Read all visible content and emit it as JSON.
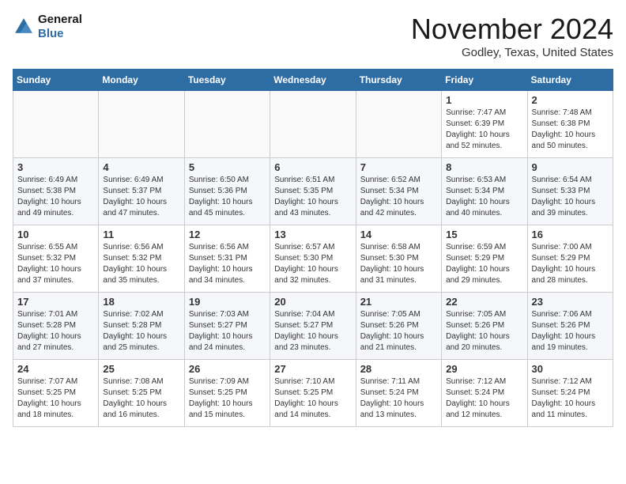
{
  "header": {
    "logo_line1": "General",
    "logo_line2": "Blue",
    "month": "November 2024",
    "location": "Godley, Texas, United States"
  },
  "weekdays": [
    "Sunday",
    "Monday",
    "Tuesday",
    "Wednesday",
    "Thursday",
    "Friday",
    "Saturday"
  ],
  "weeks": [
    [
      {
        "day": "",
        "info": ""
      },
      {
        "day": "",
        "info": ""
      },
      {
        "day": "",
        "info": ""
      },
      {
        "day": "",
        "info": ""
      },
      {
        "day": "",
        "info": ""
      },
      {
        "day": "1",
        "info": "Sunrise: 7:47 AM\nSunset: 6:39 PM\nDaylight: 10 hours\nand 52 minutes."
      },
      {
        "day": "2",
        "info": "Sunrise: 7:48 AM\nSunset: 6:38 PM\nDaylight: 10 hours\nand 50 minutes."
      }
    ],
    [
      {
        "day": "3",
        "info": "Sunrise: 6:49 AM\nSunset: 5:38 PM\nDaylight: 10 hours\nand 49 minutes."
      },
      {
        "day": "4",
        "info": "Sunrise: 6:49 AM\nSunset: 5:37 PM\nDaylight: 10 hours\nand 47 minutes."
      },
      {
        "day": "5",
        "info": "Sunrise: 6:50 AM\nSunset: 5:36 PM\nDaylight: 10 hours\nand 45 minutes."
      },
      {
        "day": "6",
        "info": "Sunrise: 6:51 AM\nSunset: 5:35 PM\nDaylight: 10 hours\nand 43 minutes."
      },
      {
        "day": "7",
        "info": "Sunrise: 6:52 AM\nSunset: 5:34 PM\nDaylight: 10 hours\nand 42 minutes."
      },
      {
        "day": "8",
        "info": "Sunrise: 6:53 AM\nSunset: 5:34 PM\nDaylight: 10 hours\nand 40 minutes."
      },
      {
        "day": "9",
        "info": "Sunrise: 6:54 AM\nSunset: 5:33 PM\nDaylight: 10 hours\nand 39 minutes."
      }
    ],
    [
      {
        "day": "10",
        "info": "Sunrise: 6:55 AM\nSunset: 5:32 PM\nDaylight: 10 hours\nand 37 minutes."
      },
      {
        "day": "11",
        "info": "Sunrise: 6:56 AM\nSunset: 5:32 PM\nDaylight: 10 hours\nand 35 minutes."
      },
      {
        "day": "12",
        "info": "Sunrise: 6:56 AM\nSunset: 5:31 PM\nDaylight: 10 hours\nand 34 minutes."
      },
      {
        "day": "13",
        "info": "Sunrise: 6:57 AM\nSunset: 5:30 PM\nDaylight: 10 hours\nand 32 minutes."
      },
      {
        "day": "14",
        "info": "Sunrise: 6:58 AM\nSunset: 5:30 PM\nDaylight: 10 hours\nand 31 minutes."
      },
      {
        "day": "15",
        "info": "Sunrise: 6:59 AM\nSunset: 5:29 PM\nDaylight: 10 hours\nand 29 minutes."
      },
      {
        "day": "16",
        "info": "Sunrise: 7:00 AM\nSunset: 5:29 PM\nDaylight: 10 hours\nand 28 minutes."
      }
    ],
    [
      {
        "day": "17",
        "info": "Sunrise: 7:01 AM\nSunset: 5:28 PM\nDaylight: 10 hours\nand 27 minutes."
      },
      {
        "day": "18",
        "info": "Sunrise: 7:02 AM\nSunset: 5:28 PM\nDaylight: 10 hours\nand 25 minutes."
      },
      {
        "day": "19",
        "info": "Sunrise: 7:03 AM\nSunset: 5:27 PM\nDaylight: 10 hours\nand 24 minutes."
      },
      {
        "day": "20",
        "info": "Sunrise: 7:04 AM\nSunset: 5:27 PM\nDaylight: 10 hours\nand 23 minutes."
      },
      {
        "day": "21",
        "info": "Sunrise: 7:05 AM\nSunset: 5:26 PM\nDaylight: 10 hours\nand 21 minutes."
      },
      {
        "day": "22",
        "info": "Sunrise: 7:05 AM\nSunset: 5:26 PM\nDaylight: 10 hours\nand 20 minutes."
      },
      {
        "day": "23",
        "info": "Sunrise: 7:06 AM\nSunset: 5:26 PM\nDaylight: 10 hours\nand 19 minutes."
      }
    ],
    [
      {
        "day": "24",
        "info": "Sunrise: 7:07 AM\nSunset: 5:25 PM\nDaylight: 10 hours\nand 18 minutes."
      },
      {
        "day": "25",
        "info": "Sunrise: 7:08 AM\nSunset: 5:25 PM\nDaylight: 10 hours\nand 16 minutes."
      },
      {
        "day": "26",
        "info": "Sunrise: 7:09 AM\nSunset: 5:25 PM\nDaylight: 10 hours\nand 15 minutes."
      },
      {
        "day": "27",
        "info": "Sunrise: 7:10 AM\nSunset: 5:25 PM\nDaylight: 10 hours\nand 14 minutes."
      },
      {
        "day": "28",
        "info": "Sunrise: 7:11 AM\nSunset: 5:24 PM\nDaylight: 10 hours\nand 13 minutes."
      },
      {
        "day": "29",
        "info": "Sunrise: 7:12 AM\nSunset: 5:24 PM\nDaylight: 10 hours\nand 12 minutes."
      },
      {
        "day": "30",
        "info": "Sunrise: 7:12 AM\nSunset: 5:24 PM\nDaylight: 10 hours\nand 11 minutes."
      }
    ]
  ]
}
